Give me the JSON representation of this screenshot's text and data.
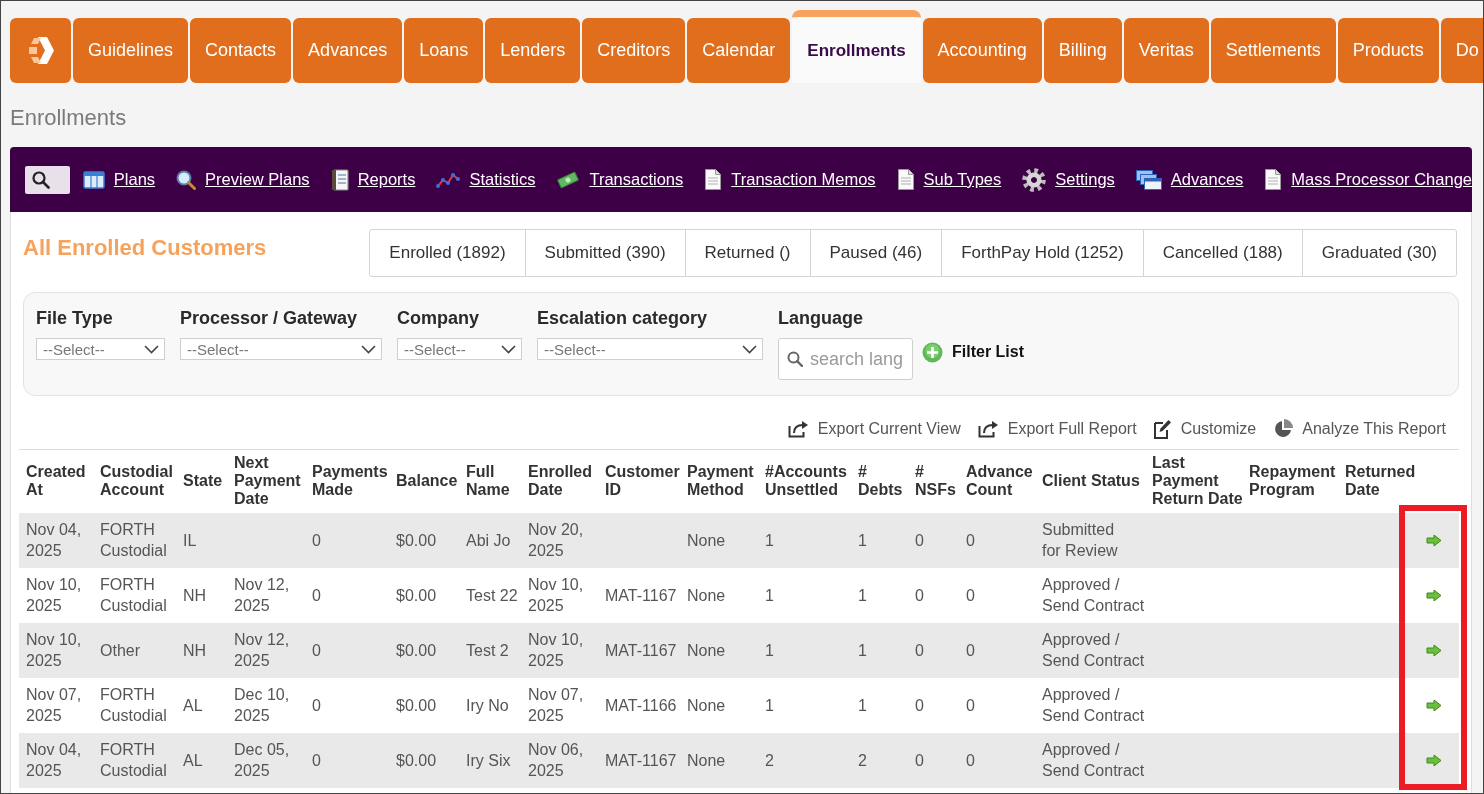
{
  "nav": {
    "tabs": [
      {
        "label": "Guidelines",
        "selected": false
      },
      {
        "label": "Contacts",
        "selected": false
      },
      {
        "label": "Advances",
        "selected": false
      },
      {
        "label": "Loans",
        "selected": false
      },
      {
        "label": "Lenders",
        "selected": false
      },
      {
        "label": "Creditors",
        "selected": false
      },
      {
        "label": "Calendar",
        "selected": false
      },
      {
        "label": "Enrollments",
        "selected": true
      },
      {
        "label": "Accounting",
        "selected": false
      },
      {
        "label": "Billing",
        "selected": false
      },
      {
        "label": "Veritas",
        "selected": false
      },
      {
        "label": "Settlements",
        "selected": false
      },
      {
        "label": "Products",
        "selected": false
      },
      {
        "label": "Do",
        "selected": false
      }
    ]
  },
  "page_title": "Enrollments",
  "toolbar": {
    "links": [
      {
        "label": "Plans",
        "kind": "table"
      },
      {
        "label": "Preview Plans",
        "kind": "magnifier"
      },
      {
        "label": "Reports",
        "kind": "notebook"
      },
      {
        "label": "Statistics",
        "kind": "linechart"
      },
      {
        "label": "Transactions",
        "kind": "money"
      },
      {
        "label": "Transaction Memos",
        "kind": "document"
      },
      {
        "label": "Sub Types",
        "kind": "document"
      },
      {
        "label": "Settings",
        "kind": "gear"
      },
      {
        "label": "Advances",
        "kind": "windows"
      },
      {
        "label": "Mass Processor Change",
        "kind": "document"
      }
    ]
  },
  "section_title": "All Enrolled Customers",
  "status_tabs": [
    {
      "label": "Enrolled (1892)",
      "selected": false
    },
    {
      "label": "Submitted (390)",
      "selected": false
    },
    {
      "label": "Returned ()",
      "selected": false
    },
    {
      "label": "Paused (46)",
      "selected": false
    },
    {
      "label": "ForthPay Hold (1252)",
      "selected": false
    },
    {
      "label": "Cancelled (188)",
      "selected": false
    },
    {
      "label": "Graduated (30)",
      "selected": false
    }
  ],
  "filters": [
    {
      "label": "File Type",
      "kind": "select",
      "value": "--Select--"
    },
    {
      "label": "Processor / Gateway",
      "kind": "select",
      "value": "--Select--"
    },
    {
      "label": "Company",
      "kind": "select",
      "value": "--Select--"
    },
    {
      "label": "Escalation category",
      "kind": "select",
      "value": "--Select--"
    },
    {
      "label": "Language",
      "kind": "search",
      "placeholder": "search lang"
    }
  ],
  "filter_button": "Filter List",
  "report_actions": [
    {
      "label": "Export Current View",
      "kind": "export"
    },
    {
      "label": "Export Full Report",
      "kind": "export"
    },
    {
      "label": "Customize",
      "kind": "edit"
    },
    {
      "label": "Analyze This Report",
      "kind": "pie"
    }
  ],
  "table": {
    "action_column_highlighted": true,
    "columns": [
      "Created At",
      "Custodial Account",
      "State",
      "Next Payment Date",
      "Payments Made",
      "Balance",
      "Full Name",
      "Enrolled Date",
      "Customer ID",
      "Payment Method",
      "#Accounts Unsettled",
      "# Debts",
      "# NSFs",
      "Advance Count",
      "Client Status",
      "Last Payment Return Date",
      "Repayment Program",
      "Returned Date"
    ],
    "rows": [
      {
        "created_at": "Nov 04, 2025",
        "custodial_account": "FORTH Custodial",
        "state": "IL",
        "payments_made": "0",
        "balance": "$0.00",
        "full_name": "Abi Jo",
        "enrolled_date": "Nov 20, 2025",
        "payment_method": "None",
        "accounts_unsettled": "1",
        "debts": "1",
        "nsfs": "0",
        "advance_count": "0",
        "client_status": "Submitted\nfor Review"
      },
      {
        "created_at": "Nov 10, 2025",
        "custodial_account": "FORTH Custodial",
        "state": "NH",
        "next_payment_date": "Nov 12, 2025",
        "payments_made": "0",
        "balance": "$0.00",
        "full_name": "Test 22",
        "enrolled_date": "Nov 10, 2025",
        "customer_id": "MAT-1167",
        "payment_method": "None",
        "accounts_unsettled": "1",
        "debts": "1",
        "nsfs": "0",
        "advance_count": "0",
        "client_status": "Approved / Send Contract"
      },
      {
        "created_at": "Nov 10, 2025",
        "custodial_account": "Other",
        "state": "NH",
        "next_payment_date": "Nov 12, 2025",
        "payments_made": "0",
        "balance": "$0.00",
        "full_name": "Test 2",
        "enrolled_date": "Nov 10, 2025",
        "customer_id": "MAT-1167",
        "payment_method": "None",
        "accounts_unsettled": "1",
        "debts": "1",
        "nsfs": "0",
        "advance_count": "0",
        "client_status": "Approved / Send Contract"
      },
      {
        "created_at": "Nov 07, 2025",
        "custodial_account": "FORTH Custodial",
        "state": "AL",
        "next_payment_date": "Dec 10, 2025",
        "payments_made": "0",
        "balance": "$0.00",
        "full_name": "Iry No",
        "enrolled_date": "Nov 07, 2025",
        "customer_id": "MAT-1166",
        "payment_method": "None",
        "accounts_unsettled": "1",
        "debts": "1",
        "nsfs": "0",
        "advance_count": "0",
        "client_status": "Approved / Send Contract"
      },
      {
        "created_at": "Nov 04, 2025",
        "custodial_account": "FORTH Custodial",
        "state": "AL",
        "next_payment_date": "Dec 05, 2025",
        "payments_made": "0",
        "balance": "$0.00",
        "full_name": "Iry Six",
        "enrolled_date": "Nov 06, 2025",
        "customer_id": "MAT-1167",
        "payment_method": "None",
        "accounts_unsettled": "2",
        "debts": "2",
        "nsfs": "0",
        "advance_count": "0",
        "client_status": "Approved / Send Contract"
      }
    ]
  }
}
